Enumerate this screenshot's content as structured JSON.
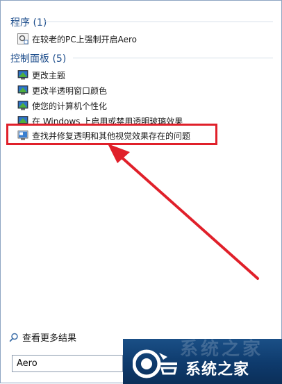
{
  "groups": [
    {
      "heading": "程序 (1)",
      "items": [
        {
          "label": "在较老的PC上强制开启Aero",
          "icon": "program-shortcut-icon"
        }
      ]
    },
    {
      "heading": "控制面板 (5)",
      "items": [
        {
          "label": "更改主题",
          "icon": "control-panel-icon"
        },
        {
          "label": "更改半透明窗口颜色",
          "icon": "control-panel-icon"
        },
        {
          "label": "使您的计算机个性化",
          "icon": "control-panel-icon"
        },
        {
          "label": "在 Windows 上启用或禁用透明玻璃效果",
          "icon": "control-panel-icon"
        },
        {
          "label": "查找并修复透明和其他视觉效果存在的问题",
          "icon": "troubleshoot-icon"
        }
      ]
    }
  ],
  "more_results": {
    "label": "查看更多结果",
    "icon": "search-icon"
  },
  "search": {
    "value": "Aero"
  },
  "watermark": {
    "site_name": "系统之家",
    "faded_text": "系统之家"
  },
  "colors": {
    "heading": "#1e4e8c",
    "highlight": "#e0202a",
    "arrow": "#e0202a",
    "watermark_bg": "#0e3a6c"
  }
}
